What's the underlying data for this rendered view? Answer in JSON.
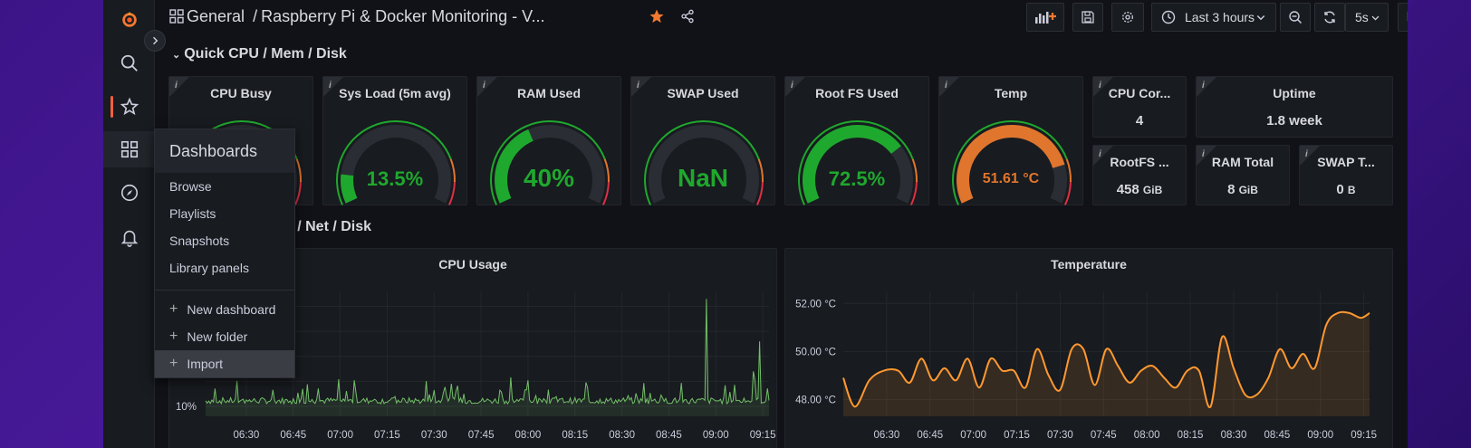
{
  "header": {
    "folder": "General",
    "separator": "/",
    "title": "Raspberry Pi & Docker Monitoring - V...",
    "time_range": "Last 3 hours",
    "refresh_interval": "5s"
  },
  "rows": {
    "row1": "Quick CPU / Mem / Disk",
    "row2_partial": "n / Net / Disk"
  },
  "gauges": [
    {
      "title": "CPU Busy",
      "value": "",
      "fraction": 0.15,
      "color": "#e0752d"
    },
    {
      "title": "Sys Load (5m avg)",
      "value": "13.5%",
      "fraction": 0.135,
      "color": "#1fa82e"
    },
    {
      "title": "RAM Used",
      "value": "40%",
      "fraction": 0.4,
      "color": "#1fa82e"
    },
    {
      "title": "SWAP Used",
      "value": "NaN",
      "fraction": 0,
      "color": "#1fa82e"
    },
    {
      "title": "Root FS Used",
      "value": "72.5%",
      "fraction": 0.725,
      "color": "#1fa82e"
    },
    {
      "title": "Temp",
      "value": "51.61 °C",
      "fraction": 0.82,
      "color": "#e0752d"
    }
  ],
  "stats": [
    {
      "title": "CPU Cor...",
      "value": "4"
    },
    {
      "title": "Uptime",
      "value": "1.8 week"
    },
    {
      "title": "RootFS ...",
      "value": "458",
      "unit": "GiB"
    },
    {
      "title": "RAM Total",
      "value": "8",
      "unit": "GiB"
    },
    {
      "title": "SWAP T...",
      "value": "0",
      "unit": "B"
    }
  ],
  "dropdown": {
    "header": "Dashboards",
    "items": [
      "Browse",
      "Playlists",
      "Snapshots",
      "Library panels"
    ],
    "actions": [
      "New dashboard",
      "New folder",
      "Import"
    ]
  },
  "colors": {
    "green": "#1fa82e",
    "orange": "#e0752d",
    "red": "#e02f44",
    "accent": "#f55f3e",
    "cpu_line": "#73bf69",
    "temp_line": "#ff9830"
  },
  "chart_data": [
    {
      "type": "line",
      "title": "CPU Usage",
      "x_ticks": [
        "06:30",
        "06:45",
        "07:00",
        "07:15",
        "07:30",
        "07:45",
        "08:00",
        "08:15",
        "08:30",
        "08:45",
        "09:00",
        "09:15"
      ],
      "y_ticks": [
        "10%"
      ],
      "series": [
        {
          "baseline": 11,
          "spikes": [
            {
              "time": "08:57",
              "value": 53
            },
            {
              "time": "09:14",
              "value": 36
            },
            {
              "time": "09:12",
              "value": 24
            }
          ]
        }
      ]
    },
    {
      "type": "area",
      "title": "Temperature",
      "x_ticks": [
        "06:30",
        "06:45",
        "07:00",
        "07:15",
        "07:30",
        "07:45",
        "08:00",
        "08:15",
        "08:30",
        "08:45",
        "09:00",
        "09:15"
      ],
      "y_ticks": [
        "52.00 °C",
        "50.00 °C",
        "48.00 °C"
      ],
      "ylim": [
        47.3,
        52.5
      ],
      "series": [
        {
          "x": [
            "06:15",
            "06:19",
            "06:24",
            "06:29",
            "06:34",
            "06:38",
            "06:42",
            "06:46",
            "06:50",
            "06:54",
            "06:58",
            "07:02",
            "07:06",
            "07:10",
            "07:14",
            "07:18",
            "07:22",
            "07:26",
            "07:30",
            "07:34",
            "07:38",
            "07:42",
            "07:46",
            "07:50",
            "07:54",
            "07:58",
            "08:02",
            "08:06",
            "08:10",
            "08:14",
            "08:18",
            "08:22",
            "08:26",
            "08:30",
            "08:34",
            "08:38",
            "08:42",
            "08:46",
            "08:50",
            "08:54",
            "08:58",
            "09:02",
            "09:06",
            "09:10",
            "09:14",
            "09:17"
          ],
          "values": [
            48.9,
            47.7,
            48.8,
            49.2,
            49.2,
            48.7,
            49.7,
            48.8,
            49.3,
            48.8,
            49.7,
            48.5,
            49.7,
            49.2,
            49.2,
            48.5,
            50.1,
            49.0,
            48.4,
            50.1,
            50.1,
            48.6,
            50.1,
            49.4,
            48.7,
            49.2,
            49.4,
            48.9,
            48.5,
            49.2,
            49.2,
            47.7,
            50.6,
            49.3,
            48.2,
            48.2,
            48.9,
            50.1,
            49.3,
            49.9,
            49.3,
            51.1,
            51.6,
            51.6,
            51.4,
            51.6
          ]
        }
      ]
    }
  ]
}
